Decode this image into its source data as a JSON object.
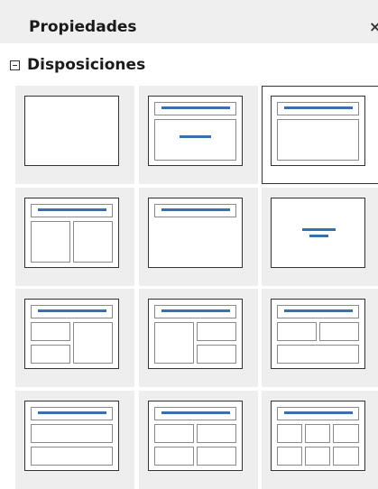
{
  "panel": {
    "title": "Propiedades",
    "close_icon": "close-icon",
    "section_title": "Disposiciones",
    "collapse_icon": "collapse-minus-icon"
  },
  "layouts": [
    {
      "kind": "blank",
      "selected": false
    },
    {
      "kind": "title-content-centered",
      "selected": false
    },
    {
      "kind": "title-content",
      "selected": true
    },
    {
      "kind": "title-2-content",
      "selected": false
    },
    {
      "kind": "title-only",
      "selected": false
    },
    {
      "kind": "centered-text",
      "selected": false
    },
    {
      "kind": "title-2-content-and-content",
      "selected": false
    },
    {
      "kind": "title-content-and-2-content",
      "selected": false
    },
    {
      "kind": "title-2-content-over-content",
      "selected": false
    },
    {
      "kind": "title-content-over-content",
      "selected": false
    },
    {
      "kind": "title-4-content",
      "selected": false
    },
    {
      "kind": "title-6-content",
      "selected": false
    }
  ]
}
